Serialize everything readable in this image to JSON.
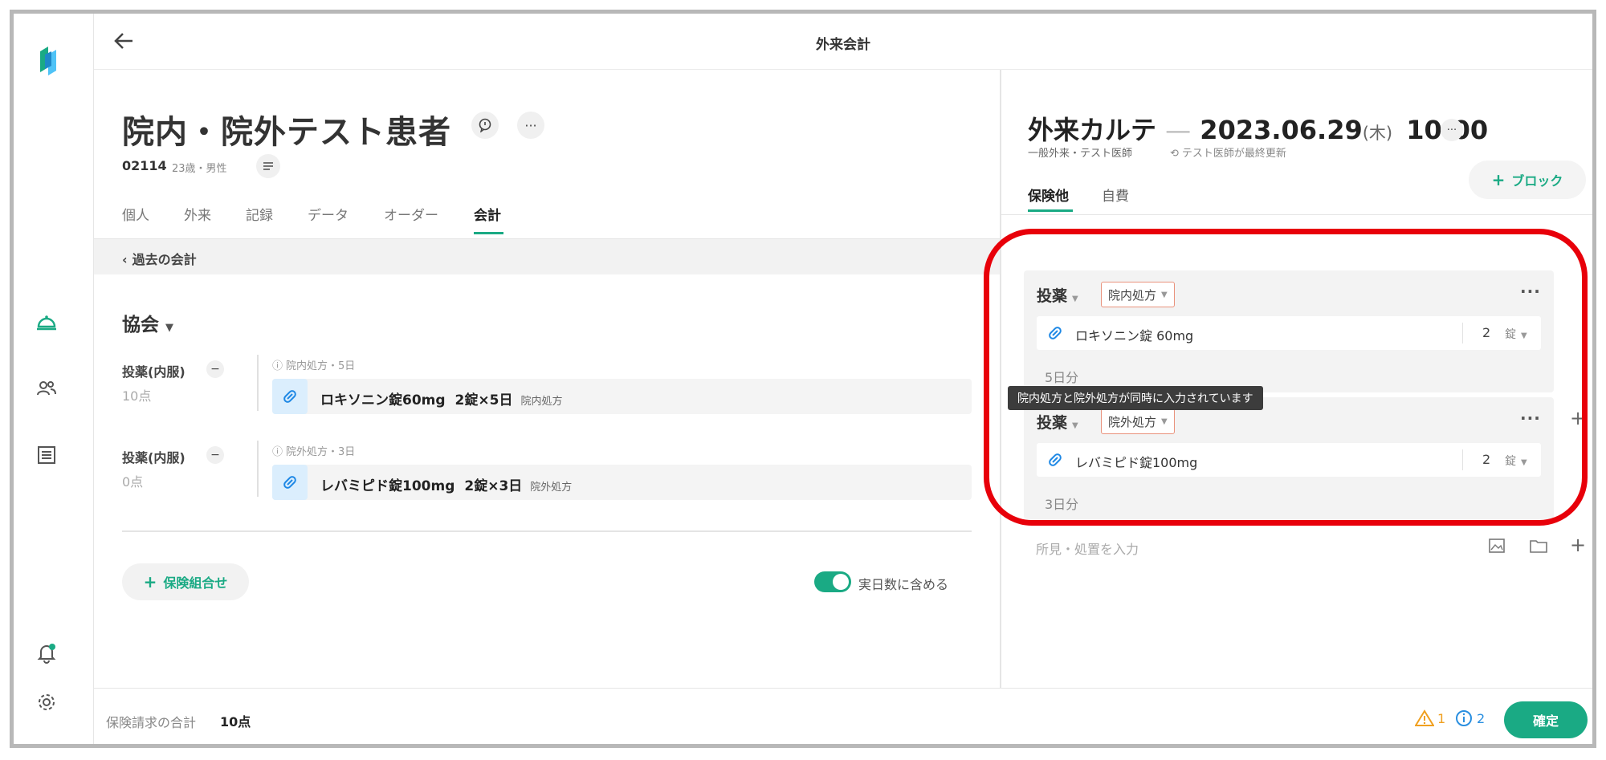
{
  "topbar": {
    "title": "外来会計"
  },
  "patient": {
    "name": "院内・院外テスト患者",
    "id": "02114",
    "info": "23歳・男性"
  },
  "tabs": [
    {
      "label": "個人"
    },
    {
      "label": "外来"
    },
    {
      "label": "記録"
    },
    {
      "label": "データ"
    },
    {
      "label": "オーダー"
    },
    {
      "label": "会計"
    }
  ],
  "past_accounts": "過去の会計",
  "insurer": "協会",
  "left_entries": [
    {
      "category": "投薬(内服)",
      "points": "10点",
      "meta": "院内処方・5日",
      "drug": "ロキソニン錠60mg",
      "dose": "2錠×5日",
      "type": "院内処方"
    },
    {
      "category": "投薬(内服)",
      "points": "0点",
      "meta": "院外処方・3日",
      "drug": "レバミピド錠100mg",
      "dose": "2錠×3日",
      "type": "院外処方"
    }
  ],
  "insurance_combo": "保険組合せ",
  "toggle_label": "実日数に含める",
  "karte": {
    "title": "外来カルテ",
    "dash": "—",
    "date": "2023.06.29",
    "dow": "(木)",
    "time": "10:00",
    "dept": "一般外来・テスト医師",
    "updated": "テスト医師が最終更新",
    "tabs": [
      {
        "label": "保険他"
      },
      {
        "label": "自費"
      }
    ],
    "block_button": "ブロック"
  },
  "cards": [
    {
      "label": "投薬",
      "tag": "院内処方",
      "drug": "ロキソニン錠 60mg",
      "qty": "2",
      "unit": "錠",
      "days": "5日分"
    },
    {
      "label": "投薬",
      "tag": "院外処方",
      "drug": "レバミピド錠100mg",
      "qty": "2",
      "unit": "錠",
      "days": "3日分"
    }
  ],
  "tooltip": "院内処方と院外処方が同時に入力されています",
  "finding_placeholder": "所見・処置を入力",
  "footer": {
    "total_label": "保険請求の合計",
    "total_value": "10点",
    "warning_count": "1",
    "info_count": "2",
    "confirm": "確定"
  },
  "colors": {
    "accent": "#1aaa84",
    "highlight": "#e8000a",
    "tag_border": "#e9927c"
  }
}
